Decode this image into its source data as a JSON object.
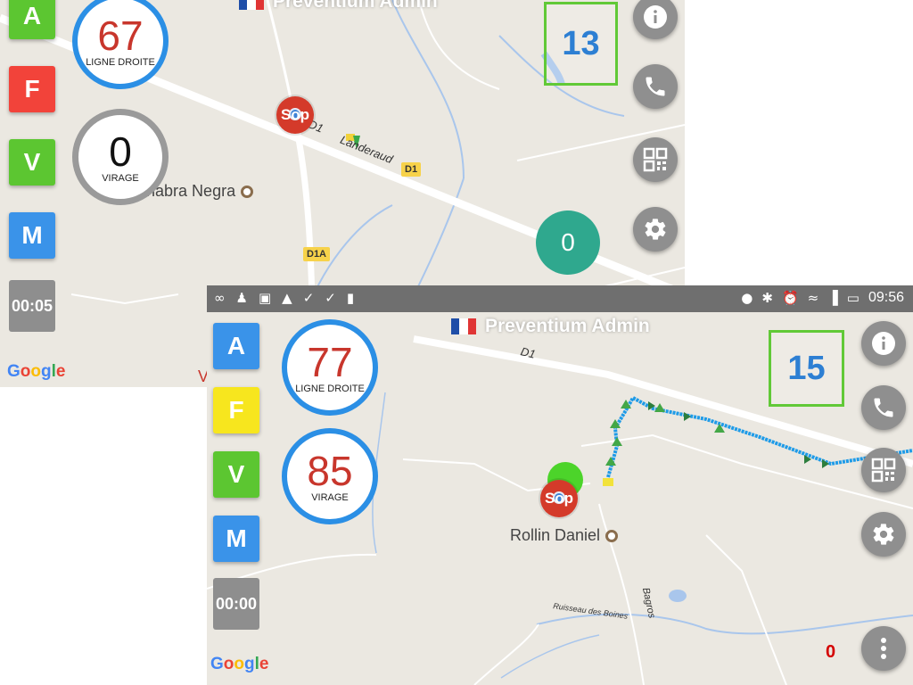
{
  "back": {
    "app_title": "Preventium Admin",
    "side_buttons": [
      {
        "label": "A",
        "color": "#5cc631"
      },
      {
        "label": "F",
        "color": "#f2433a"
      },
      {
        "label": "V",
        "color": "#5cc631"
      },
      {
        "label": "M",
        "color": "#3a93e9"
      }
    ],
    "timer": "00:05",
    "gauge_top": {
      "value": "67",
      "label": "LIGNE DROITE"
    },
    "gauge_bottom": {
      "value": "0",
      "label": "VIRAGE"
    },
    "counter": "13",
    "teal_badge": "0",
    "map": {
      "road_d1": "D1",
      "road_name": "Landeraud",
      "shield_d1": "D1",
      "shield_d1a": "D1A",
      "poi": "La Chabra Negra",
      "stop_label": "Sop",
      "cut_label": "V",
      "google": "Google"
    }
  },
  "front": {
    "status_bar": {
      "left_icons": [
        "voicemail-icon",
        "person-icon",
        "image-icon",
        "navigation-icon",
        "check-icon",
        "check-icon",
        "sdcard-icon"
      ],
      "time": "09:56"
    },
    "app_title": "Preventium Admin",
    "side_buttons": [
      {
        "label": "A",
        "color": "#3a93e9"
      },
      {
        "label": "F",
        "color": "#f7e61e"
      },
      {
        "label": "V",
        "color": "#5cc631"
      },
      {
        "label": "M",
        "color": "#3a93e9"
      }
    ],
    "timer": "00:00",
    "gauge_top": {
      "value": "77",
      "label": "LIGNE DROITE"
    },
    "gauge_bottom": {
      "value": "85",
      "label": "VIRAGE"
    },
    "counter": "15",
    "alert_count": "0",
    "map": {
      "road_d1": "D1",
      "poi": "Rollin Daniel",
      "stream": "Ruisseau des Boines",
      "road_bagros": "Bagros",
      "stop_label": "Sop",
      "google": "Google"
    }
  },
  "colors": {
    "gauge_ring_blue": "#2b8fe5",
    "gauge_ring_gray": "#9a9a9a",
    "value_red": "#c8362c",
    "counter_border": "#61c937",
    "counter_text": "#2d7fd3",
    "track_blue": "#1e9be8"
  },
  "fab_icons": [
    "info-icon",
    "phone-icon",
    "qr-code-icon",
    "gear-icon",
    "more-vert-icon"
  ]
}
